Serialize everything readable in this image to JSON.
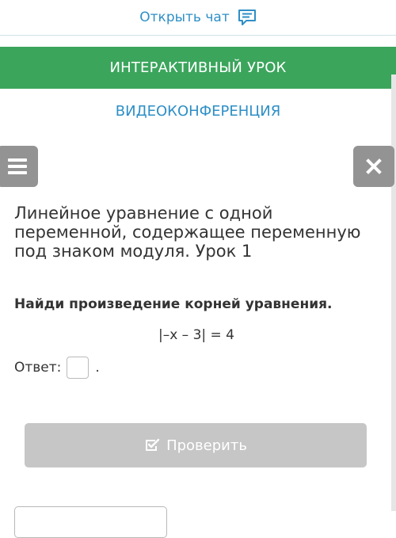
{
  "header": {
    "open_chat_label": "Открыть чат",
    "chat_icon": "chat-icon"
  },
  "mode_bar": {
    "interactive_lesson_label": "ИНТЕРАКТИВНЫЙ УРОК",
    "videoconference_label": "ВИДЕОКОНФЕРЕНЦИЯ"
  },
  "controls": {
    "menu_icon": "hamburger-icon",
    "close_icon": "close-icon"
  },
  "lesson": {
    "title": "Линейное уравнение с одной переменной, содержащее переменную под знаком модуля. Урок 1",
    "task": "Найди произведение корней уравнения.",
    "equation": "|–x – 3| = 4",
    "answer_label": "Ответ:",
    "answer_value": "",
    "answer_suffix": "."
  },
  "actions": {
    "check_label": "Проверить",
    "check_icon": "checkbox-check-icon"
  },
  "colors": {
    "accent_blue": "#2e8fc6",
    "green_bar": "#3ba55c",
    "button_gray": "#939393",
    "disabled_button": "#c6c6c6"
  }
}
